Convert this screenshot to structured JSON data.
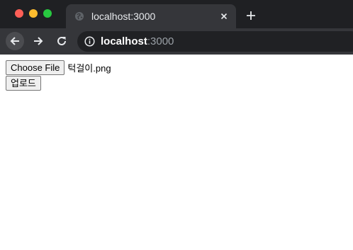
{
  "browser": {
    "tab": {
      "title": "localhost:3000",
      "close_icon": "close-icon",
      "favicon": "globe-icon"
    },
    "new_tab_icon": "plus-icon",
    "nav": {
      "back_icon": "arrow-left-icon",
      "forward_icon": "arrow-right-icon",
      "reload_icon": "reload-icon"
    },
    "address": {
      "host": "localhost",
      "port": ":3000",
      "info_icon": "info-icon"
    }
  },
  "page": {
    "file_input": {
      "button_label": "Choose File",
      "file_name": "턱걸이.png"
    },
    "upload_button": {
      "label": "업로드"
    }
  }
}
